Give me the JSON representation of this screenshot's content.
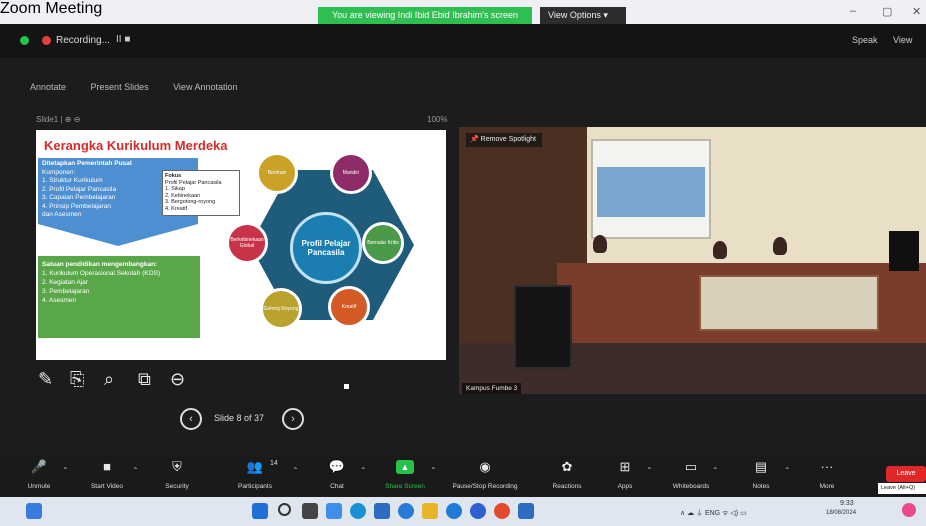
{
  "window": {
    "title": "Zoom Meeting",
    "share_banner": "You are viewing Indi Ibid Ebid Ibrahim's screen",
    "view_options": "View Options",
    "controls": [
      "–",
      "▢",
      "✕"
    ]
  },
  "meeting_header": {
    "recording_label": "Recording...",
    "recording_controls": "II ■",
    "right_items": [
      "Speak",
      "View"
    ]
  },
  "annotation_bar": {
    "items": [
      "Annotate",
      "Present Slides",
      "View Annotation"
    ]
  },
  "slide_meta": {
    "left": "Slide1 | ⊕ ⊖",
    "right": "100%"
  },
  "slide": {
    "title": "Kerangka Kurikulum Merdeka",
    "blue_heading": "Ditetapkan Pemerintah Pusat",
    "blue_lines": [
      "Komponen:",
      "1. Struktur Kurikulum",
      "2. Profil Pelajar Pancasila",
      "3. Capaian Pembelajaran",
      "4. Prinsip Pembelajaran",
      "   dan Asesmen"
    ],
    "green_heading": "Satuan pendidikan mengembangkan:",
    "green_lines": [
      "1. Kurikulum Operasional Sekolah (KOS)",
      "2. Kegiatan Ajar",
      "3. Pembelajaran",
      "4. Asesmen"
    ],
    "profil_box": [
      "Fokus",
      "Profil Pelajar Pancasila",
      "1. Sikap",
      "2. Kebinekaan",
      "3. Bergotong-royong",
      "4. Kreatif"
    ],
    "center_label": "Profil Pelajar Pancasila",
    "petals": [
      "Beriman",
      "Mandiri",
      "Bernalar Kritis",
      "Kreatif",
      "Gotong Royong",
      "Berkebinekaan Global"
    ]
  },
  "slide_nav": {
    "counter": "Slide 8 of 37",
    "prev": "‹",
    "next": "›"
  },
  "slide_tools": [
    "✎",
    "⎘",
    "⌕",
    "⧉",
    "⊖"
  ],
  "video": {
    "spotlight_label": "Remove Spotlight",
    "participant_name": "Kampus Fumbe 3"
  },
  "toolbar": {
    "items": [
      {
        "icon": "🎤",
        "label": "Unmute"
      },
      {
        "icon": "■",
        "label": "Start Video"
      },
      {
        "icon": "⛨",
        "label": "Security"
      },
      {
        "icon": "👥",
        "label": "Participants",
        "badge": "14"
      },
      {
        "icon": "💬",
        "label": "Chat"
      },
      {
        "icon": "▲",
        "label": "Share Screen",
        "active": true
      },
      {
        "icon": "◉",
        "label": "Pause/Stop Recording"
      },
      {
        "icon": "✿",
        "label": "Reactions"
      },
      {
        "icon": "⊞",
        "label": "Apps"
      },
      {
        "icon": "▭",
        "label": "Whiteboards"
      },
      {
        "icon": "▤",
        "label": "Notes"
      },
      {
        "icon": "···",
        "label": "More"
      }
    ],
    "leave_label": "Leave",
    "tooltip": "Leave (Alt+Q)"
  },
  "taskbar": {
    "clock_time": "9:33",
    "clock_date": "18/08/2024",
    "tray": "∧ ☁ ⏚ ENG ᯤ ◁) ▭"
  },
  "colors": {
    "share_green": "#2fbe52",
    "leave_red": "#e02828",
    "slide_title_red": "#d82a2a",
    "slide_blue": "#4d8fd1",
    "slide_green": "#5aa74a"
  }
}
